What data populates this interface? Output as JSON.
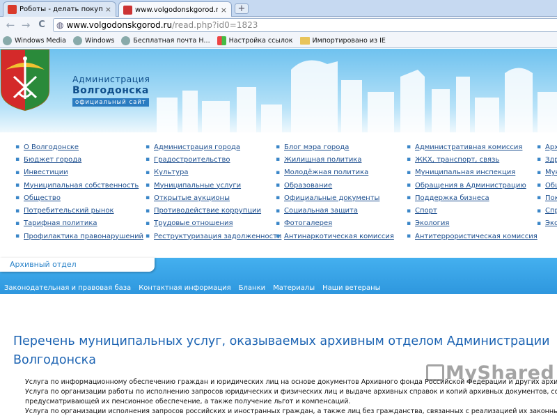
{
  "browser": {
    "tabs": [
      {
        "title": "Роботы - делать покупки в и",
        "favicon_color": "#d93a2b",
        "active": false
      },
      {
        "title": "www.volgodonskgorod.ru/rea",
        "favicon_color": "#c33",
        "active": true
      }
    ],
    "new_tab_label": "+",
    "close_glyph": "×",
    "back_glyph": "←",
    "forward_glyph": "→",
    "reload_glyph": "C",
    "address": {
      "host": "www.volgodonskgorod.ru",
      "path": "/read.php?id0=1823"
    },
    "bookmarks": [
      {
        "label": "Windows Media",
        "icon": "globe-icon"
      },
      {
        "label": "Windows",
        "icon": "globe-icon"
      },
      {
        "label": "Бесплатная почта Н...",
        "icon": "globe-icon"
      },
      {
        "label": "Настройка ссылок",
        "icon": "windows-icon"
      },
      {
        "label": "Импортировано из IE",
        "icon": "folder-icon"
      }
    ]
  },
  "site": {
    "brand": {
      "line1": "Администрация",
      "line2": "Волгодонска",
      "line3": "официальный сайт"
    },
    "menu_columns": [
      [
        "О Волгодонске",
        "Бюджет города",
        "Инвестиции",
        "Муниципальная собственность",
        "Общество",
        "Потребительский рынок",
        "Тарифная политика",
        "Профилактика правонарушений"
      ],
      [
        "Администрация города",
        "Градостроительство",
        "Культура",
        "Муниципальные услуги",
        "Открытые аукционы",
        "Противодействие коррупции",
        "Трудовые отношения",
        "Реструктуризация задолженности"
      ],
      [
        "Блог мэра города",
        "Жилищная политика",
        "Молодёжная политика",
        "Образование",
        "Официальные документы",
        "Социальная защита",
        "Фотогалерея",
        "Антинаркотическая комиссия"
      ],
      [
        "Административная комиссия",
        "ЖКХ, транспорт, связь",
        "Муниципальная инспекция",
        "Обращения в Администрацию",
        "Поддержка бизнеса",
        "Спорт",
        "Экология",
        "Антитеррористическая комиссия"
      ],
      [
        "Арх",
        "Здр",
        "Мун",
        "Общ",
        "Пок",
        "Спр",
        "Экс"
      ]
    ],
    "section_tab": "Архивный отдел",
    "subnav": [
      "Законодательная и правовая база",
      "Контактная информация",
      "Бланки",
      "Материалы",
      "Наши ветераны"
    ],
    "page_title_line1": "Перечень муниципальных услуг, оказываемых архивным отделом Администрации",
    "page_title_line2": "Волгодонска",
    "list": [
      {
        "num": "1.",
        "text": "Услуга по информационному обеспечению граждан и юридических лиц на основе документов Архивного фонда Российской Федерации и других архивных документов"
      },
      {
        "num": "2.",
        "text": "Услуга по организации работы по исполнению запросов юридических и физических лиц и выдаче архивных справок и копий архивных документов, содержащих сведения,"
      },
      {
        "num": "",
        "text": "предусматривающей их пенсионное обеспечение, а также получение льгот и компенсаций."
      },
      {
        "num": "3.",
        "text": "Услуга по организации исполнения запросов российских и иностранных граждан, а также лиц без гражданства, связанных с реализацией их законных прав и свобод"
      }
    ],
    "watermark": "MyShared"
  },
  "colors": {
    "accent": "#1d64b3",
    "link": "#1d4f8f",
    "band": "#2e97de",
    "sky": "#6fc2ef"
  }
}
